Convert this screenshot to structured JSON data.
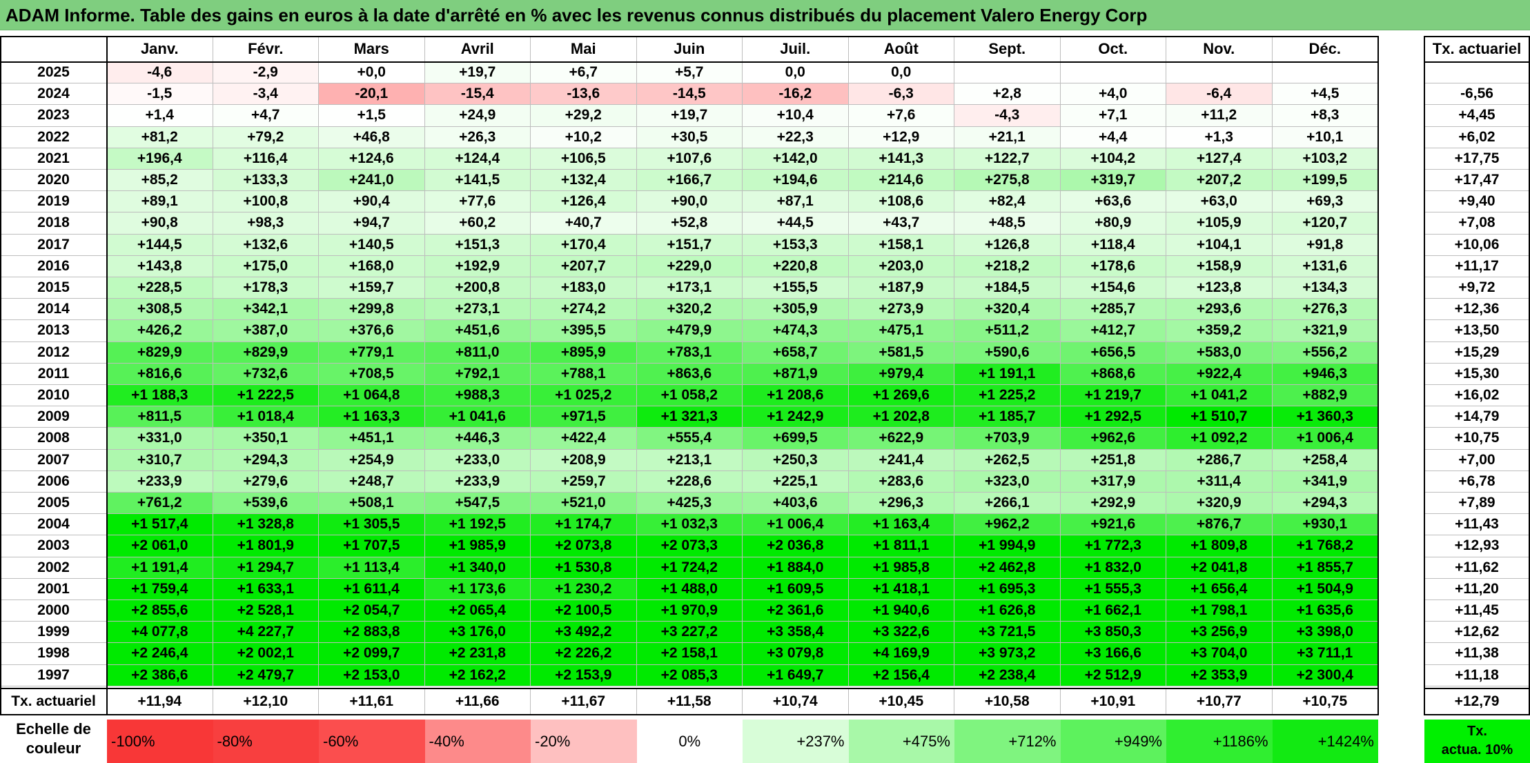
{
  "title": "ADAM Informe. Table des gains en euros à la date d'arrêté en % avec les revenus connus distribués du placement Valero Energy Corp",
  "chart_data": {
    "type": "table",
    "columns": [
      "Janv.",
      "Févr.",
      "Mars",
      "Avril",
      "Mai",
      "Juin",
      "Juil.",
      "Août",
      "Sept.",
      "Oct.",
      "Nov.",
      "Déc."
    ],
    "rate_column_label": "Tx. actuariel",
    "rows": [
      {
        "year": "2025",
        "values": [
          "-4,6",
          "-2,9",
          "+0,0",
          "+19,7",
          "+6,7",
          "+5,7",
          "0,0",
          "0,0",
          "",
          "",
          "",
          ""
        ],
        "rate": ""
      },
      {
        "year": "2024",
        "values": [
          "-1,5",
          "-3,4",
          "-20,1",
          "-15,4",
          "-13,6",
          "-14,5",
          "-16,2",
          "-6,3",
          "+2,8",
          "+4,0",
          "-6,4",
          "+4,5"
        ],
        "rate": "-6,56"
      },
      {
        "year": "2023",
        "values": [
          "+1,4",
          "+4,7",
          "+1,5",
          "+24,9",
          "+29,2",
          "+19,7",
          "+10,4",
          "+7,6",
          "-4,3",
          "+7,1",
          "+11,2",
          "+8,3"
        ],
        "rate": "+4,45"
      },
      {
        "year": "2022",
        "values": [
          "+81,2",
          "+79,2",
          "+46,8",
          "+26,3",
          "+10,2",
          "+30,5",
          "+22,3",
          "+12,9",
          "+21,1",
          "+4,4",
          "+1,3",
          "+10,1"
        ],
        "rate": "+6,02"
      },
      {
        "year": "2021",
        "values": [
          "+196,4",
          "+116,4",
          "+124,6",
          "+124,4",
          "+106,5",
          "+107,6",
          "+142,0",
          "+141,3",
          "+122,7",
          "+104,2",
          "+127,4",
          "+103,2"
        ],
        "rate": "+17,75"
      },
      {
        "year": "2020",
        "values": [
          "+85,2",
          "+133,3",
          "+241,0",
          "+141,5",
          "+132,4",
          "+166,7",
          "+194,6",
          "+214,6",
          "+275,8",
          "+319,7",
          "+207,2",
          "+199,5"
        ],
        "rate": "+17,47"
      },
      {
        "year": "2019",
        "values": [
          "+89,1",
          "+100,8",
          "+90,4",
          "+77,6",
          "+126,4",
          "+90,0",
          "+87,1",
          "+108,6",
          "+82,4",
          "+63,6",
          "+63,0",
          "+69,3"
        ],
        "rate": "+9,40"
      },
      {
        "year": "2018",
        "values": [
          "+90,8",
          "+98,3",
          "+94,7",
          "+60,2",
          "+40,7",
          "+52,8",
          "+44,5",
          "+43,7",
          "+48,5",
          "+80,9",
          "+105,9",
          "+120,7"
        ],
        "rate": "+7,08"
      },
      {
        "year": "2017",
        "values": [
          "+144,5",
          "+132,6",
          "+140,5",
          "+151,3",
          "+170,4",
          "+151,7",
          "+153,3",
          "+158,1",
          "+126,8",
          "+118,4",
          "+104,1",
          "+91,8"
        ],
        "rate": "+10,06"
      },
      {
        "year": "2016",
        "values": [
          "+143,8",
          "+175,0",
          "+168,0",
          "+192,9",
          "+207,7",
          "+229,0",
          "+220,8",
          "+203,0",
          "+218,2",
          "+178,6",
          "+158,9",
          "+131,6"
        ],
        "rate": "+11,17"
      },
      {
        "year": "2015",
        "values": [
          "+228,5",
          "+178,3",
          "+159,7",
          "+200,8",
          "+183,0",
          "+173,1",
          "+155,5",
          "+187,9",
          "+184,5",
          "+154,6",
          "+123,8",
          "+134,3"
        ],
        "rate": "+9,72"
      },
      {
        "year": "2014",
        "values": [
          "+308,5",
          "+342,1",
          "+299,8",
          "+273,1",
          "+274,2",
          "+320,2",
          "+305,9",
          "+273,9",
          "+320,4",
          "+285,7",
          "+293,6",
          "+276,3"
        ],
        "rate": "+12,36"
      },
      {
        "year": "2013",
        "values": [
          "+426,2",
          "+387,0",
          "+376,6",
          "+451,6",
          "+395,5",
          "+479,9",
          "+474,3",
          "+475,1",
          "+511,2",
          "+412,7",
          "+359,2",
          "+321,9"
        ],
        "rate": "+13,50"
      },
      {
        "year": "2012",
        "values": [
          "+829,9",
          "+829,9",
          "+779,1",
          "+811,0",
          "+895,9",
          "+783,1",
          "+658,7",
          "+581,5",
          "+590,6",
          "+656,5",
          "+583,0",
          "+556,2"
        ],
        "rate": "+15,29"
      },
      {
        "year": "2011",
        "values": [
          "+816,6",
          "+732,6",
          "+708,5",
          "+792,1",
          "+788,1",
          "+863,6",
          "+871,9",
          "+979,4",
          "+1 191,1",
          "+868,6",
          "+922,4",
          "+946,3"
        ],
        "rate": "+15,30"
      },
      {
        "year": "2010",
        "values": [
          "+1 188,3",
          "+1 222,5",
          "+1 064,8",
          "+988,3",
          "+1 025,2",
          "+1 058,2",
          "+1 208,6",
          "+1 269,6",
          "+1 225,2",
          "+1 219,7",
          "+1 041,2",
          "+882,9"
        ],
        "rate": "+16,02"
      },
      {
        "year": "2009",
        "values": [
          "+811,5",
          "+1 018,4",
          "+1 163,3",
          "+1 041,6",
          "+971,5",
          "+1 321,3",
          "+1 242,9",
          "+1 202,8",
          "+1 185,7",
          "+1 292,5",
          "+1 510,7",
          "+1 360,3"
        ],
        "rate": "+14,79"
      },
      {
        "year": "2008",
        "values": [
          "+331,0",
          "+350,1",
          "+451,1",
          "+446,3",
          "+422,4",
          "+555,4",
          "+699,5",
          "+622,9",
          "+703,9",
          "+962,6",
          "+1 092,2",
          "+1 006,4"
        ],
        "rate": "+10,75"
      },
      {
        "year": "2007",
        "values": [
          "+310,7",
          "+294,3",
          "+254,9",
          "+233,0",
          "+208,9",
          "+213,1",
          "+250,3",
          "+241,4",
          "+262,5",
          "+251,8",
          "+286,7",
          "+258,4"
        ],
        "rate": "+7,00"
      },
      {
        "year": "2006",
        "values": [
          "+233,9",
          "+279,6",
          "+248,7",
          "+233,9",
          "+259,7",
          "+228,6",
          "+225,1",
          "+283,6",
          "+323,0",
          "+317,9",
          "+311,4",
          "+341,9"
        ],
        "rate": "+6,78"
      },
      {
        "year": "2005",
        "values": [
          "+761,2",
          "+539,6",
          "+508,1",
          "+547,5",
          "+521,0",
          "+425,3",
          "+403,6",
          "+296,3",
          "+266,1",
          "+292,9",
          "+320,9",
          "+294,3"
        ],
        "rate": "+7,89"
      },
      {
        "year": "2004",
        "values": [
          "+1 517,4",
          "+1 328,8",
          "+1 305,5",
          "+1 192,5",
          "+1 174,7",
          "+1 032,3",
          "+1 006,4",
          "+1 163,4",
          "+962,2",
          "+921,6",
          "+876,7",
          "+930,1"
        ],
        "rate": "+11,43"
      },
      {
        "year": "2003",
        "values": [
          "+2 061,0",
          "+1 801,9",
          "+1 707,5",
          "+1 985,9",
          "+2 073,8",
          "+2 073,3",
          "+2 036,8",
          "+1 811,1",
          "+1 994,9",
          "+1 772,3",
          "+1 809,8",
          "+1 768,2"
        ],
        "rate": "+12,93"
      },
      {
        "year": "2002",
        "values": [
          "+1 191,4",
          "+1 294,7",
          "+1 113,4",
          "+1 340,0",
          "+1 530,8",
          "+1 724,2",
          "+1 884,0",
          "+1 985,8",
          "+2 462,8",
          "+1 832,0",
          "+2 041,8",
          "+1 855,7"
        ],
        "rate": "+11,62"
      },
      {
        "year": "2001",
        "values": [
          "+1 759,4",
          "+1 633,1",
          "+1 611,4",
          "+1 173,6",
          "+1 230,2",
          "+1 488,0",
          "+1 609,5",
          "+1 418,1",
          "+1 695,3",
          "+1 555,3",
          "+1 656,4",
          "+1 504,9"
        ],
        "rate": "+11,20"
      },
      {
        "year": "2000",
        "values": [
          "+2 855,6",
          "+2 528,1",
          "+2 054,7",
          "+2 065,4",
          "+2 100,5",
          "+1 970,9",
          "+2 361,6",
          "+1 940,6",
          "+1 626,8",
          "+1 662,1",
          "+1 798,1",
          "+1 635,6"
        ],
        "rate": "+11,45"
      },
      {
        "year": "1999",
        "values": [
          "+4 077,8",
          "+4 227,7",
          "+2 883,8",
          "+3 176,0",
          "+3 492,2",
          "+3 227,2",
          "+3 358,4",
          "+3 322,6",
          "+3 721,5",
          "+3 850,3",
          "+3 256,9",
          "+3 398,0"
        ],
        "rate": "+12,62"
      },
      {
        "year": "1998",
        "values": [
          "+2 246,4",
          "+2 002,1",
          "+2 099,7",
          "+2 231,8",
          "+2 226,2",
          "+2 158,1",
          "+3 079,8",
          "+4 169,9",
          "+3 973,2",
          "+3 166,6",
          "+3 704,0",
          "+3 711,1"
        ],
        "rate": "+11,38"
      },
      {
        "year": "1997",
        "values": [
          "+2 386,6",
          "+2 479,7",
          "+2 153,0",
          "+2 162,2",
          "+2 153,9",
          "+2 085,3",
          "+1 649,7",
          "+2 156,4",
          "+2 238,4",
          "+2 512,9",
          "+2 353,9",
          "+2 300,4"
        ],
        "rate": "+11,18"
      }
    ],
    "summary_row": {
      "label": "Tx. actuariel",
      "values": [
        "+11,94",
        "+12,10",
        "+11,61",
        "+11,66",
        "+11,67",
        "+11,58",
        "+10,74",
        "+10,45",
        "+10,58",
        "+10,91",
        "+10,77",
        "+10,75"
      ],
      "overall": "+12,79"
    },
    "color_scale": {
      "title_line1": "Echelle de",
      "title_line2": "couleur",
      "steps": [
        {
          "label": "-100%",
          "color": "#f83737"
        },
        {
          "label": "-80%",
          "color": "#f83f3f"
        },
        {
          "label": "-60%",
          "color": "#fb4e4e"
        },
        {
          "label": "-40%",
          "color": "#fd8a8a"
        },
        {
          "label": "-20%",
          "color": "#fec0c0"
        },
        {
          "label": "0%",
          "color": "#ffffff"
        },
        {
          "label": "+237%",
          "color": "#d8fdd8"
        },
        {
          "label": "+475%",
          "color": "#a8f8a8"
        },
        {
          "label": "+712%",
          "color": "#7ff47f"
        },
        {
          "label": "+949%",
          "color": "#5df25d"
        },
        {
          "label": "+1186%",
          "color": "#30ee30"
        },
        {
          "label": "+1424%",
          "color": "#12ea12"
        }
      ],
      "legend_line1": "Tx.",
      "legend_line2": "actua. 10%",
      "legend_color": "#00f000"
    }
  }
}
